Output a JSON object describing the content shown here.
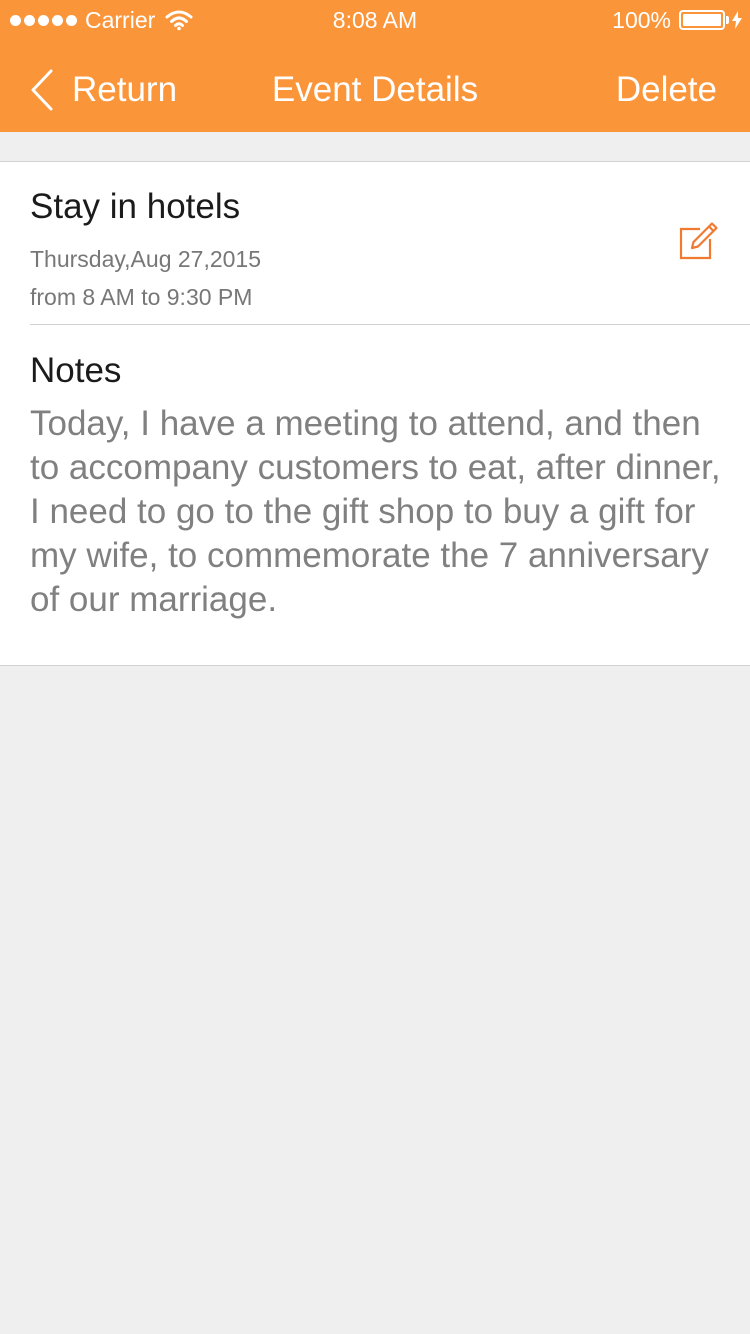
{
  "status_bar": {
    "carrier": "Carrier",
    "time": "8:08 AM",
    "battery": "100%"
  },
  "nav": {
    "back_label": "Return",
    "title": "Event Details",
    "delete_label": "Delete"
  },
  "event": {
    "title": "Stay in hotels",
    "date": "Thursday,Aug 27,2015",
    "time_range": "from 8 AM to 9:30 PM"
  },
  "notes": {
    "heading": "Notes",
    "body": "Today, I have a meeting to attend, and then to accompany customers to eat, after dinner, I need to go to the gift shop to buy a gift for my wife, to commemorate the 7 anniversary of our marriage."
  },
  "colors": {
    "accent": "#fb953a",
    "edit_icon": "#f07a30",
    "background": "#efefef"
  },
  "icons": {
    "back": "chevron-left-icon",
    "edit": "edit-icon",
    "wifi": "wifi-icon",
    "battery": "battery-icon",
    "charging": "bolt-icon"
  }
}
